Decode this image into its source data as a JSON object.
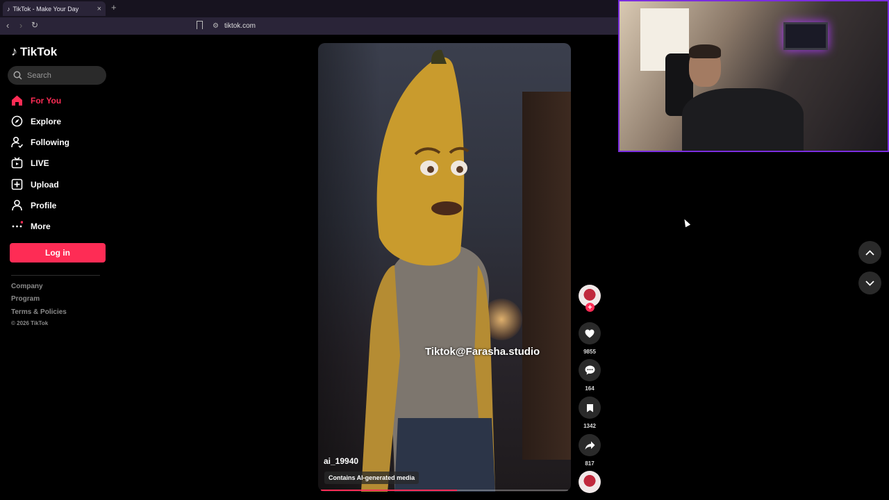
{
  "browser": {
    "tab_title": "TikTok - Make Your Day",
    "tab_close": "×",
    "new_tab": "+",
    "url": "tiktok.com"
  },
  "sidebar": {
    "logo": "TikTok",
    "search_placeholder": "Search",
    "items": [
      {
        "label": "For You",
        "icon": "home-icon",
        "active": true
      },
      {
        "label": "Explore",
        "icon": "compass-icon"
      },
      {
        "label": "Following",
        "icon": "following-icon"
      },
      {
        "label": "LIVE",
        "icon": "live-icon"
      },
      {
        "label": "Upload",
        "icon": "upload-icon"
      },
      {
        "label": "Profile",
        "icon": "profile-icon"
      },
      {
        "label": "More",
        "icon": "more-icon"
      }
    ],
    "login_label": "Log in",
    "footer_links": [
      "Company",
      "Program",
      "Terms & Policies"
    ],
    "copyright": "© 2026 TikTok"
  },
  "video": {
    "watermark": "Tiktok@Farasha.studio",
    "author": "ai_19940",
    "ai_badge": "Contains AI-generated media",
    "progress": 0.55
  },
  "actions": {
    "likes": "9855",
    "comments": "164",
    "saves": "1342",
    "shares": "817"
  },
  "colors": {
    "accent": "#fe2c55",
    "webcam_border": "#7b2de0"
  }
}
